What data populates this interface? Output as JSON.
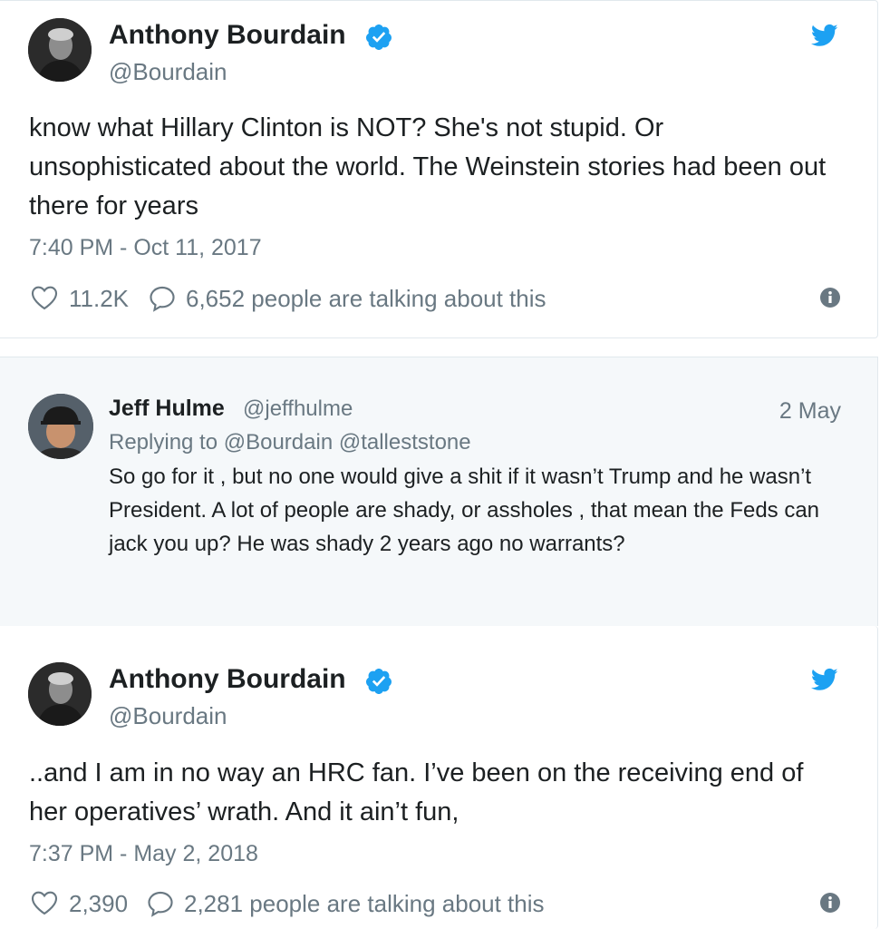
{
  "tweets": [
    {
      "author": "Anthony Bourdain",
      "handle": "@Bourdain",
      "text": "know what Hillary Clinton is NOT? She's not stupid. Or unsophisticated about the world. The Weinstein stories had been out there for years",
      "time": "7:40 PM - Oct 11, 2017",
      "likes": "11.2K",
      "talking": "6,652 people are talking about this"
    },
    {
      "author": "Anthony Bourdain",
      "handle": "@Bourdain",
      "text": "..and I am in no way an HRC fan. I’ve been on the receiving end of her operatives’ wrath. And it ain’t fun,",
      "time": "7:37 PM - May 2, 2018",
      "likes": "2,390",
      "talking": "2,281 people are talking about this"
    }
  ],
  "reply": {
    "author": "Jeff Hulme",
    "handle": "@jeffhulme",
    "date": "2 May",
    "replying_to": "Replying to @Bourdain @talleststone",
    "text": "So go for it , but no one would give a shit if it wasn’t Trump and he wasn’t President. A lot of people are shady, or assholes , that mean the Feds can jack you up? He was shady 2 years ago no warrants?"
  },
  "icons": {
    "verified": "verified-badge-icon",
    "brand": "twitter-bird-icon",
    "like": "heart-icon",
    "reply": "speech-bubble-icon",
    "info": "info-icon"
  },
  "colors": {
    "twitter_blue": "#1da1f2",
    "muted_text": "#697882",
    "reply_background": "#f5f8fa"
  }
}
